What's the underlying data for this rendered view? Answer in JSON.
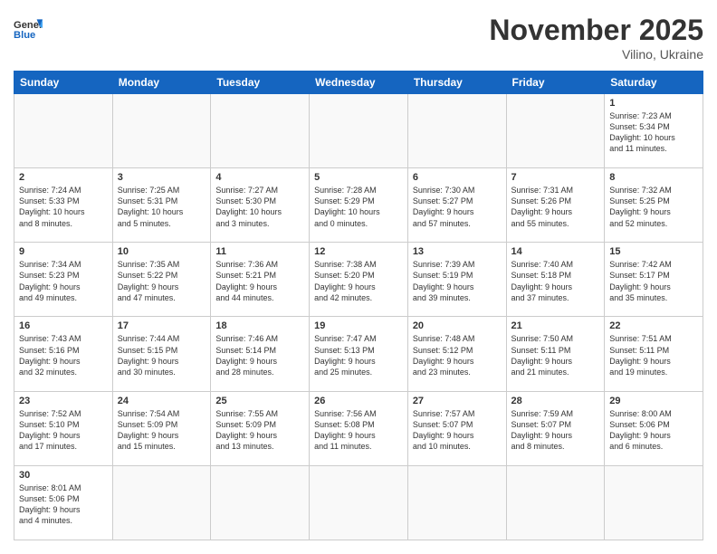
{
  "header": {
    "logo_general": "General",
    "logo_blue": "Blue",
    "month_title": "November 2025",
    "subtitle": "Vilino, Ukraine"
  },
  "weekdays": [
    "Sunday",
    "Monday",
    "Tuesday",
    "Wednesday",
    "Thursday",
    "Friday",
    "Saturday"
  ],
  "weeks": [
    [
      {
        "day": "",
        "info": ""
      },
      {
        "day": "",
        "info": ""
      },
      {
        "day": "",
        "info": ""
      },
      {
        "day": "",
        "info": ""
      },
      {
        "day": "",
        "info": ""
      },
      {
        "day": "",
        "info": ""
      },
      {
        "day": "1",
        "info": "Sunrise: 7:23 AM\nSunset: 5:34 PM\nDaylight: 10 hours\nand 11 minutes."
      }
    ],
    [
      {
        "day": "2",
        "info": "Sunrise: 7:24 AM\nSunset: 5:33 PM\nDaylight: 10 hours\nand 8 minutes."
      },
      {
        "day": "3",
        "info": "Sunrise: 7:25 AM\nSunset: 5:31 PM\nDaylight: 10 hours\nand 5 minutes."
      },
      {
        "day": "4",
        "info": "Sunrise: 7:27 AM\nSunset: 5:30 PM\nDaylight: 10 hours\nand 3 minutes."
      },
      {
        "day": "5",
        "info": "Sunrise: 7:28 AM\nSunset: 5:29 PM\nDaylight: 10 hours\nand 0 minutes."
      },
      {
        "day": "6",
        "info": "Sunrise: 7:30 AM\nSunset: 5:27 PM\nDaylight: 9 hours\nand 57 minutes."
      },
      {
        "day": "7",
        "info": "Sunrise: 7:31 AM\nSunset: 5:26 PM\nDaylight: 9 hours\nand 55 minutes."
      },
      {
        "day": "8",
        "info": "Sunrise: 7:32 AM\nSunset: 5:25 PM\nDaylight: 9 hours\nand 52 minutes."
      }
    ],
    [
      {
        "day": "9",
        "info": "Sunrise: 7:34 AM\nSunset: 5:23 PM\nDaylight: 9 hours\nand 49 minutes."
      },
      {
        "day": "10",
        "info": "Sunrise: 7:35 AM\nSunset: 5:22 PM\nDaylight: 9 hours\nand 47 minutes."
      },
      {
        "day": "11",
        "info": "Sunrise: 7:36 AM\nSunset: 5:21 PM\nDaylight: 9 hours\nand 44 minutes."
      },
      {
        "day": "12",
        "info": "Sunrise: 7:38 AM\nSunset: 5:20 PM\nDaylight: 9 hours\nand 42 minutes."
      },
      {
        "day": "13",
        "info": "Sunrise: 7:39 AM\nSunset: 5:19 PM\nDaylight: 9 hours\nand 39 minutes."
      },
      {
        "day": "14",
        "info": "Sunrise: 7:40 AM\nSunset: 5:18 PM\nDaylight: 9 hours\nand 37 minutes."
      },
      {
        "day": "15",
        "info": "Sunrise: 7:42 AM\nSunset: 5:17 PM\nDaylight: 9 hours\nand 35 minutes."
      }
    ],
    [
      {
        "day": "16",
        "info": "Sunrise: 7:43 AM\nSunset: 5:16 PM\nDaylight: 9 hours\nand 32 minutes."
      },
      {
        "day": "17",
        "info": "Sunrise: 7:44 AM\nSunset: 5:15 PM\nDaylight: 9 hours\nand 30 minutes."
      },
      {
        "day": "18",
        "info": "Sunrise: 7:46 AM\nSunset: 5:14 PM\nDaylight: 9 hours\nand 28 minutes."
      },
      {
        "day": "19",
        "info": "Sunrise: 7:47 AM\nSunset: 5:13 PM\nDaylight: 9 hours\nand 25 minutes."
      },
      {
        "day": "20",
        "info": "Sunrise: 7:48 AM\nSunset: 5:12 PM\nDaylight: 9 hours\nand 23 minutes."
      },
      {
        "day": "21",
        "info": "Sunrise: 7:50 AM\nSunset: 5:11 PM\nDaylight: 9 hours\nand 21 minutes."
      },
      {
        "day": "22",
        "info": "Sunrise: 7:51 AM\nSunset: 5:11 PM\nDaylight: 9 hours\nand 19 minutes."
      }
    ],
    [
      {
        "day": "23",
        "info": "Sunrise: 7:52 AM\nSunset: 5:10 PM\nDaylight: 9 hours\nand 17 minutes."
      },
      {
        "day": "24",
        "info": "Sunrise: 7:54 AM\nSunset: 5:09 PM\nDaylight: 9 hours\nand 15 minutes."
      },
      {
        "day": "25",
        "info": "Sunrise: 7:55 AM\nSunset: 5:09 PM\nDaylight: 9 hours\nand 13 minutes."
      },
      {
        "day": "26",
        "info": "Sunrise: 7:56 AM\nSunset: 5:08 PM\nDaylight: 9 hours\nand 11 minutes."
      },
      {
        "day": "27",
        "info": "Sunrise: 7:57 AM\nSunset: 5:07 PM\nDaylight: 9 hours\nand 10 minutes."
      },
      {
        "day": "28",
        "info": "Sunrise: 7:59 AM\nSunset: 5:07 PM\nDaylight: 9 hours\nand 8 minutes."
      },
      {
        "day": "29",
        "info": "Sunrise: 8:00 AM\nSunset: 5:06 PM\nDaylight: 9 hours\nand 6 minutes."
      }
    ],
    [
      {
        "day": "30",
        "info": "Sunrise: 8:01 AM\nSunset: 5:06 PM\nDaylight: 9 hours\nand 4 minutes."
      },
      {
        "day": "",
        "info": ""
      },
      {
        "day": "",
        "info": ""
      },
      {
        "day": "",
        "info": ""
      },
      {
        "day": "",
        "info": ""
      },
      {
        "day": "",
        "info": ""
      },
      {
        "day": "",
        "info": ""
      }
    ]
  ]
}
